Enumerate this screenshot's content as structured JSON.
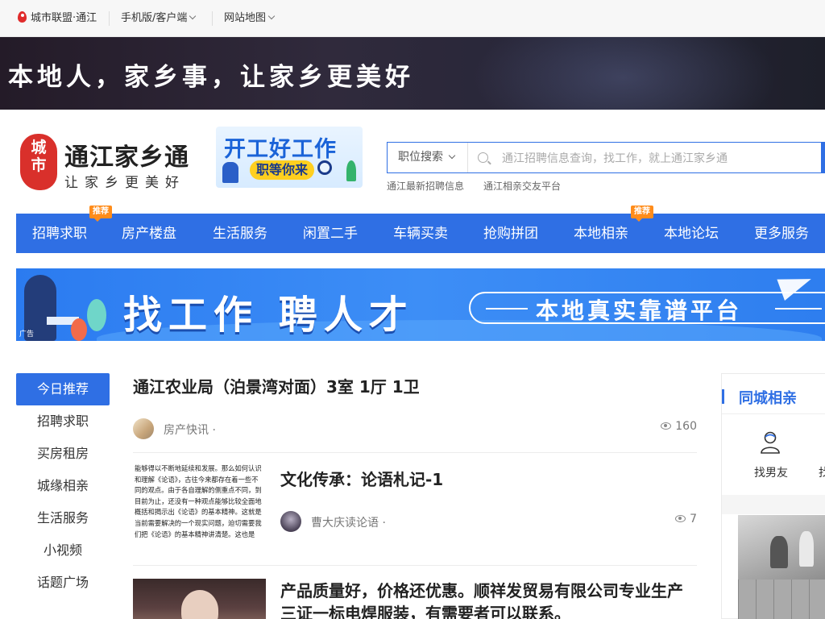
{
  "topbar": {
    "city": "城市联盟·通江",
    "mobile": "手机版/客户端",
    "sitemap": "网站地图"
  },
  "banner": {
    "slogan": "本地人，家乡事，让家乡更美好"
  },
  "brand": {
    "mark_top": "城",
    "mark_bottom": "市",
    "title": "通江家乡通",
    "subtitle": "让家乡更美好",
    "brand_color": "#d9302b"
  },
  "promo": {
    "line1": "开工好工作",
    "line2": "职等你来"
  },
  "search": {
    "category": "职位搜索",
    "placeholder": "通江招聘信息查询，找工作，就上通江家乡通",
    "hot_links": [
      "通江最新招聘信息",
      "通江相亲交友平台"
    ]
  },
  "nav": {
    "accent": "#2f6fe4",
    "items": [
      {
        "label": "招聘求职",
        "tag": "推荐"
      },
      {
        "label": "房产楼盘",
        "tag": ""
      },
      {
        "label": "生活服务",
        "tag": ""
      },
      {
        "label": "闲置二手",
        "tag": ""
      },
      {
        "label": "车辆买卖",
        "tag": ""
      },
      {
        "label": "抢购拼团",
        "tag": ""
      },
      {
        "label": "本地相亲",
        "tag": "推荐"
      },
      {
        "label": "本地论坛",
        "tag": ""
      },
      {
        "label": "更多服务",
        "tag": ""
      }
    ]
  },
  "ad": {
    "headline": "找工作 聘人才",
    "tagline": "本地真实靠谱平台",
    "ad_label": "广告"
  },
  "sidebar": {
    "items": [
      "今日推荐",
      "招聘求职",
      "买房租房",
      "城缘相亲",
      "生活服务",
      "小视频",
      "话题广场"
    ],
    "active_index": 0
  },
  "feed": {
    "articles": [
      {
        "title": "通江农业局（泊景湾对面）3室 1厅 1卫",
        "source": "房产快讯 ·",
        "views": "160"
      },
      {
        "title": "文化传承：论语札记-1",
        "source": "曹大庆读论语 ·",
        "views": "7",
        "thumb_text": "能够得以不断地延续和发展。那么如何认识和理解《论语》，古往今来都存在着一些不同的观点。由于各自理解的侧重点不同，到目前为止，还没有一种观点能够比较全面地概括和揭示出《论语》的基本精神。这就是当前需要解决的一个现实问题，迫切需要我们把《论语》的基本精神讲清楚。这也是"
      },
      {
        "title": "产品质量好，价格还优惠。顺祥发贸易有限公司专业生产三证一标电焊服装，有需要者可以联系。",
        "source": "",
        "views": ""
      }
    ]
  },
  "right_panel": {
    "title": "同城相亲",
    "option1": "找男友",
    "option2": "找"
  }
}
